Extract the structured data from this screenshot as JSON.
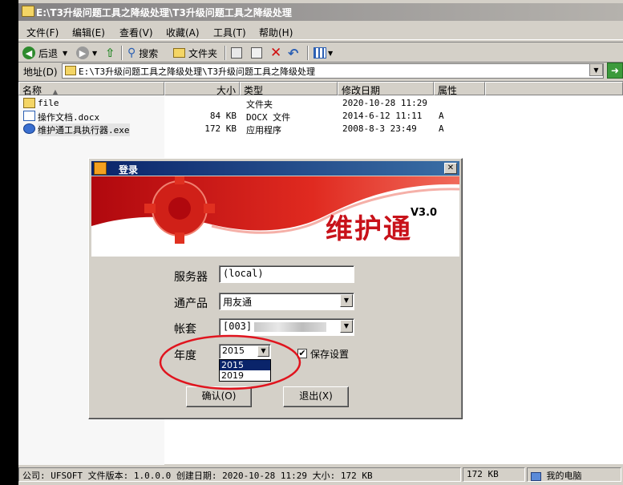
{
  "window": {
    "title": "E:\\T3升级问题工具之降级处理\\T3升级问题工具之降级处理"
  },
  "menu": [
    "文件(F)",
    "编辑(E)",
    "查看(V)",
    "收藏(A)",
    "工具(T)",
    "帮助(H)"
  ],
  "toolbar": {
    "back": "后退",
    "search": "搜索",
    "folders": "文件夹"
  },
  "address": {
    "label": "地址(D)",
    "value": "E:\\T3升级问题工具之降级处理\\T3升级问题工具之降级处理"
  },
  "columns": {
    "name": "名称",
    "size": "大小",
    "type": "类型",
    "modified": "修改日期",
    "attr": "属性"
  },
  "files": [
    {
      "name": "file",
      "size": "",
      "type": "文件夹",
      "modified": "2020-10-28 11:29",
      "attr": ""
    },
    {
      "name": "操作文档.docx",
      "size": "84 KB",
      "type": "DOCX 文件",
      "modified": "2014-6-12 11:11",
      "attr": "A"
    },
    {
      "name": "维护通工具执行器.exe",
      "size": "172 KB",
      "type": "应用程序",
      "modified": "2008-8-3 23:49",
      "attr": "A"
    }
  ],
  "status": {
    "info": "公司: UFSOFT 文件版本: 1.0.0.0 创建日期: 2020-10-28 11:29 大小: 172 KB",
    "size": "172 KB",
    "location": "我的电脑"
  },
  "dialog": {
    "title": "登录",
    "brand": "维护通",
    "version": "V3.0",
    "server_label": "服务器",
    "server_value": "(local)",
    "product_label": "通产品",
    "product_value": "用友通",
    "account_label": "帐套",
    "account_value": "[003]",
    "year_label": "年度",
    "year_value": "2015",
    "year_options": [
      "2015",
      "2019"
    ],
    "save_label": "保存设置",
    "ok_label": "确认(O)",
    "exit_label": "退出(X)"
  },
  "colors": {
    "brand_red": "#c8121a",
    "dialog_title": "#0a246a",
    "annotation": "#e0141e"
  }
}
